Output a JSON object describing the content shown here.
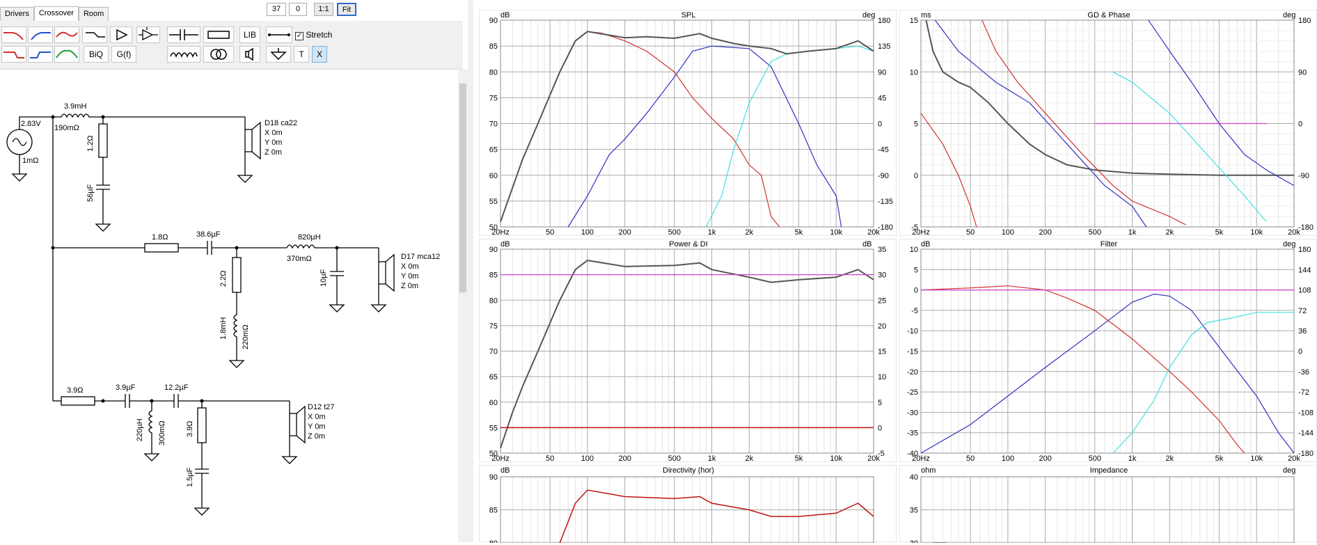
{
  "tabs": [
    "Drivers",
    "Crossover",
    "Room"
  ],
  "top_controls": {
    "val1": "37",
    "val2": "0",
    "one_to_one": "1:1",
    "fit": "Fit"
  },
  "toolbar": {
    "lib": "LIB",
    "stretch": "Stretch",
    "biq": "BiQ",
    "gf": "G(f)",
    "t": "T",
    "x": "X"
  },
  "schematic": {
    "source": {
      "voltage": "2.83V",
      "resistance": "1mΩ"
    },
    "labels": {
      "l1": "3.9mH",
      "l1r": "190mΩ",
      "r1": "1.2Ω",
      "c1": "56µF",
      "r2": "1.8Ω",
      "c2": "38.6µF",
      "r3": "2.2Ω",
      "l3": "1.8mH",
      "l3r": "220mΩ",
      "l2": "820µH",
      "l2r": "370mΩ",
      "c3": "10µF",
      "r4": "3.9Ω",
      "c4": "3.9µF",
      "c5": "12.2µF",
      "l4": "220µH",
      "l4r": "300mΩ",
      "r5": "3.9Ω",
      "c6": "1.5µF"
    },
    "drivers": [
      {
        "name": "D18 ca22",
        "x": "X 0m",
        "y": "Y 0m",
        "z": "Z 0m"
      },
      {
        "name": "D17 mca12",
        "x": "X 0m",
        "y": "Y 0m",
        "z": "Z 0m"
      },
      {
        "name": "D12 t27",
        "x": "X 0m",
        "y": "Y 0m",
        "z": "Z 0m"
      }
    ]
  },
  "freq_ticks": [
    "20Hz",
    "50",
    "100",
    "200",
    "500",
    "1k",
    "2k",
    "5k",
    "10k",
    "20k"
  ],
  "panels": {
    "spl": {
      "title": "SPL",
      "left_unit": "dB",
      "right_unit": "deg",
      "left_ticks": [
        "90",
        "85",
        "80",
        "75",
        "70",
        "65",
        "60",
        "55",
        "50"
      ],
      "right_ticks": [
        "180",
        "135",
        "90",
        "45",
        "0",
        "-45",
        "-90",
        "-135",
        "-180"
      ]
    },
    "gd": {
      "title": "GD & Phase",
      "left_unit": "ms",
      "right_unit": "deg",
      "left_ticks": [
        "15",
        "10",
        "5",
        "0",
        "-5"
      ],
      "right_ticks": [
        "180",
        "90",
        "0",
        "-90",
        "-180"
      ]
    },
    "power": {
      "title": "Power & DI",
      "left_unit": "dB",
      "right_unit": "dB",
      "left_ticks": [
        "90",
        "85",
        "80",
        "75",
        "70",
        "65",
        "60",
        "55",
        "50"
      ],
      "right_ticks": [
        "35",
        "30",
        "25",
        "20",
        "15",
        "10",
        "5",
        "0",
        "-5"
      ]
    },
    "filter": {
      "title": "Filter",
      "left_unit": "dB",
      "right_unit": "deg",
      "left_ticks": [
        "10",
        "5",
        "0",
        "-5",
        "-10",
        "-15",
        "-20",
        "-25",
        "-30",
        "-35",
        "-40"
      ],
      "right_ticks": [
        "180",
        "144",
        "108",
        "72",
        "36",
        "0",
        "-36",
        "-72",
        "-108",
        "-144",
        "-180"
      ]
    },
    "directivity": {
      "title": "Directivity (hor)",
      "left_unit": "dB",
      "left_ticks": [
        "90",
        "85",
        "80"
      ]
    },
    "impedance": {
      "title": "Impedance",
      "left_unit": "ohm",
      "right_unit": "deg",
      "left_ticks": [
        "40",
        "35",
        "30"
      ]
    }
  },
  "colors": {
    "red": "#d03030",
    "blue": "#3030c0",
    "cyan": "#40e0e0",
    "gray": "#555555",
    "magenta": "#d040d0",
    "darkred": "#c01010"
  }
}
